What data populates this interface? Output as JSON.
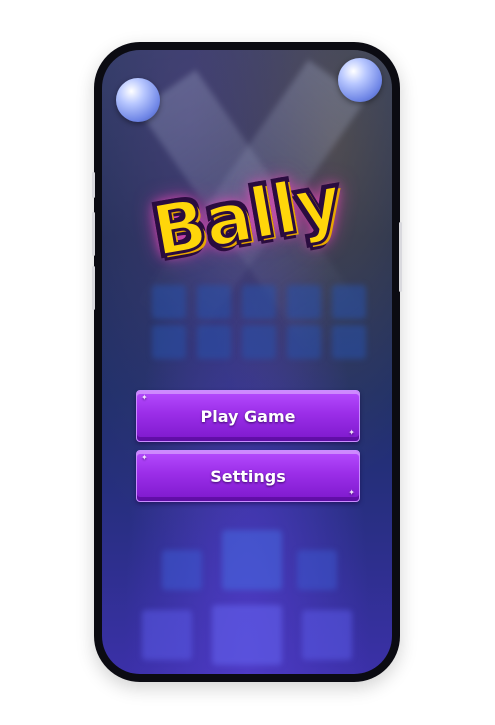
{
  "game": {
    "title": "Bally"
  },
  "menu": {
    "play_label": "Play Game",
    "settings_label": "Settings"
  },
  "colors": {
    "button_purple": "#9b2ee8",
    "logo_yellow": "#ffd60a",
    "logo_glow": "#ff3cbe",
    "background_blue": "#1d2f6a"
  },
  "icons": {
    "corner_balls": "glossy-ball-icon",
    "button_sparkle": "sparkle-icon"
  }
}
